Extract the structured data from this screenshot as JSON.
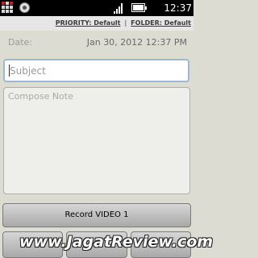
{
  "status_bar": {
    "time": "12:37 PM",
    "icons": [
      "app-grid-icon",
      "circle-icon",
      "signal-icon",
      "battery-icon"
    ]
  },
  "header": {
    "priority_link": "PRIORITY: Default",
    "separator": "|",
    "folder_link": "FOLDER: Default"
  },
  "form": {
    "date_label": "Date:",
    "date_value": "Jan 30, 2012 12:37 PM",
    "subject_placeholder": "Subject",
    "compose_placeholder": "Compose Note"
  },
  "buttons": {
    "record": "Record VIDEO 1"
  },
  "watermark": "www.JagatReview.com",
  "colors": {
    "background": "#dcdcd2",
    "focus_border": "#9bb8d4"
  }
}
